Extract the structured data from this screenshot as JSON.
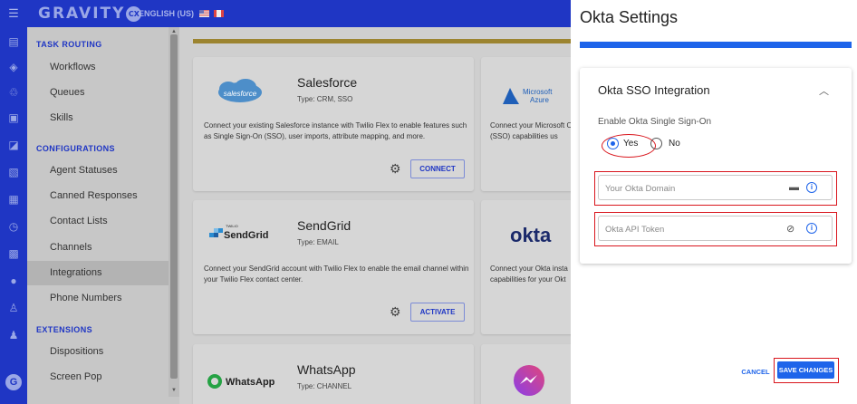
{
  "topbar": {
    "brand": "GRAVITY",
    "brand_badge": "CX",
    "language": "ENGLISH (US)"
  },
  "rail": {
    "menu_icon": "☰",
    "icons": [
      "menu-icon",
      "workflow-icon",
      "queue-icon",
      "skills-icon",
      "agent-status-icon",
      "canned-response-icon",
      "contact-list-icon",
      "history-icon",
      "channel-icon",
      "integrations-icon",
      "user-icon",
      "team-icon"
    ],
    "logo": "G"
  },
  "sidebar": {
    "sections": [
      {
        "title": "TASK ROUTING",
        "items": [
          "Workflows",
          "Queues",
          "Skills"
        ]
      },
      {
        "title": "CONFIGURATIONS",
        "items": [
          "Agent Statuses",
          "Canned Responses",
          "Contact Lists",
          "Channels",
          "Integrations",
          "Phone Numbers"
        ]
      },
      {
        "title": "EXTENSIONS",
        "items": [
          "Dispositions",
          "Screen Pop"
        ]
      }
    ],
    "active_item": "Integrations"
  },
  "cards": [
    {
      "logo": "salesforce",
      "title": "Salesforce",
      "type": "Type: CRM, SSO",
      "description": "Connect your existing Salesforce instance with Twilio Flex to enable features such as Single Sign-On (SSO), user imports, attribute mapping, and more.",
      "button": "CONNECT"
    },
    {
      "logo": "SendGrid",
      "logo_small": "TWILIO",
      "title": "SendGrid",
      "type": "Type: EMAIL",
      "description": "Connect your SendGrid account with Twilio Flex to enable the email channel within your Twilio Flex contact center.",
      "button": "ACTIVATE"
    },
    {
      "logo": "WhatsApp",
      "title": "WhatsApp",
      "type": "Type: CHANNEL"
    }
  ],
  "partial_cards": [
    {
      "logo_line1": "Microsoft",
      "logo_line2": "Azure",
      "description": "Connect your Microsoft On (SSO) capabilities us"
    },
    {
      "logo": "okta",
      "description": "Connect your Okta insta capabilities for your Okt"
    },
    {
      "logo": "messenger"
    }
  ],
  "panel": {
    "title": "Okta Settings",
    "section_title": "Okta SSO Integration",
    "enable_label": "Enable Okta Single Sign-On",
    "radio_yes": "Yes",
    "radio_no": "No",
    "selected": "Yes",
    "domain_placeholder": "Your Okta Domain",
    "token_placeholder": "Okta API Token",
    "cancel": "CANCEL",
    "save": "SAVE CHANGES"
  },
  "colors": {
    "primary": "#1f36c4",
    "accent": "#1e64ea",
    "highlight": "#d9161d"
  }
}
